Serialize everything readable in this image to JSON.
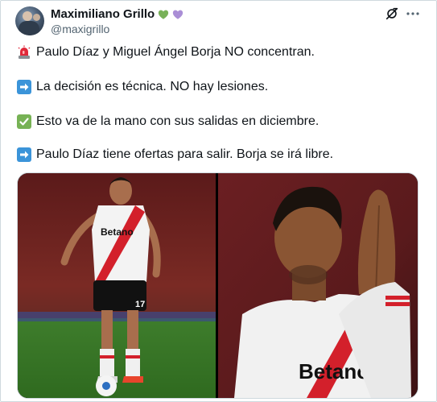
{
  "author": {
    "display_name": "Maximiliano Grillo",
    "handle": "@maxigrillo",
    "badges": [
      "green-heart-icon",
      "purple-heart-icon"
    ]
  },
  "header_actions": [
    "grok-icon",
    "more-options-icon"
  ],
  "tweet": {
    "lines": [
      {
        "icon": "police-light-icon",
        "text": "Paulo Díaz y Miguel Ángel Borja NO concentran."
      },
      {
        "icon": "right-arrow-icon",
        "text": "La decisión es técnica. NO hay lesiones."
      },
      {
        "icon": "check-mark-icon",
        "text": "Esto va de la mano con sus salidas en diciembre."
      },
      {
        "icon": "right-arrow-icon",
        "text": "Paulo Díaz tiene ofertas para salir. Borja se irá libre."
      }
    ]
  },
  "media": {
    "photo1": {
      "jersey_text": "Betano",
      "shorts_number": "17"
    },
    "photo2": {
      "jersey_text": "Betano"
    }
  },
  "colors": {
    "text": "#0f1419",
    "secondary_text": "#536471",
    "border": "#cfd9de",
    "jersey_red": "#d3202b",
    "field_green": "#3e7d2c"
  }
}
